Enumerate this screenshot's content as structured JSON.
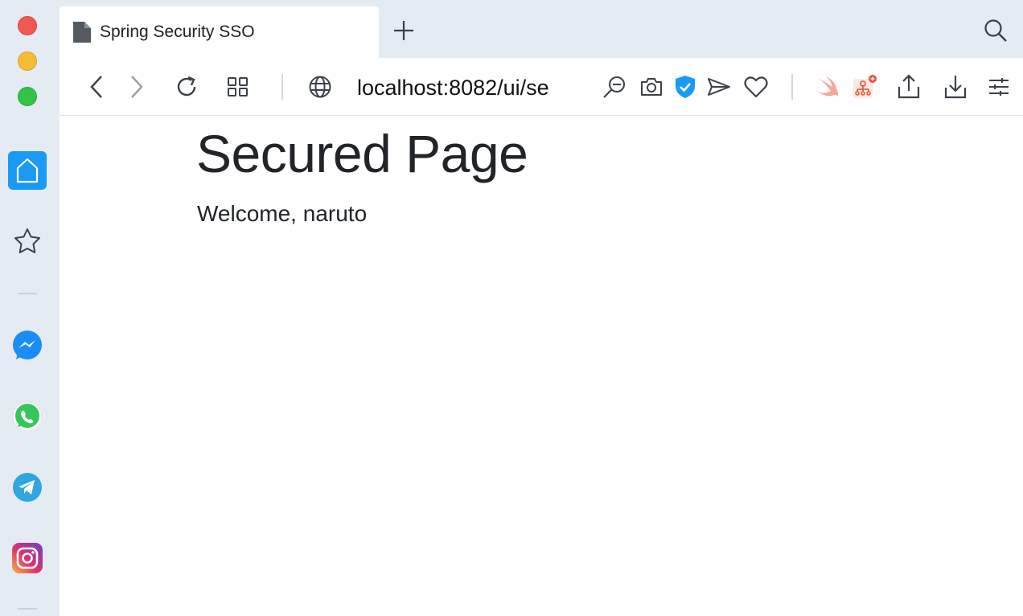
{
  "window": {
    "traffic_lights": {
      "close": "#ee5a52",
      "minimize": "#f7bb34",
      "maximize": "#35c249"
    }
  },
  "sidebar": {
    "items": [
      {
        "name": "home",
        "icon": "home-icon",
        "active": true,
        "color": "#1a9af5"
      },
      {
        "name": "bookmarks",
        "icon": "star-icon"
      },
      {
        "name": "messenger",
        "icon": "messenger-icon",
        "color": "#1a8cf5"
      },
      {
        "name": "whatsapp",
        "icon": "whatsapp-icon",
        "color": "#34c759"
      },
      {
        "name": "telegram",
        "icon": "telegram-icon",
        "color": "#2ea6df"
      },
      {
        "name": "instagram",
        "icon": "instagram-icon"
      }
    ]
  },
  "tabs": [
    {
      "title": "Spring Security SSO",
      "icon": "document-icon",
      "active": true
    }
  ],
  "toolbar": {
    "url": "localhost:8082/ui/se",
    "shield_color": "#1a9af5"
  },
  "page": {
    "title": "Secured Page",
    "welcome": "Welcome, naruto"
  }
}
